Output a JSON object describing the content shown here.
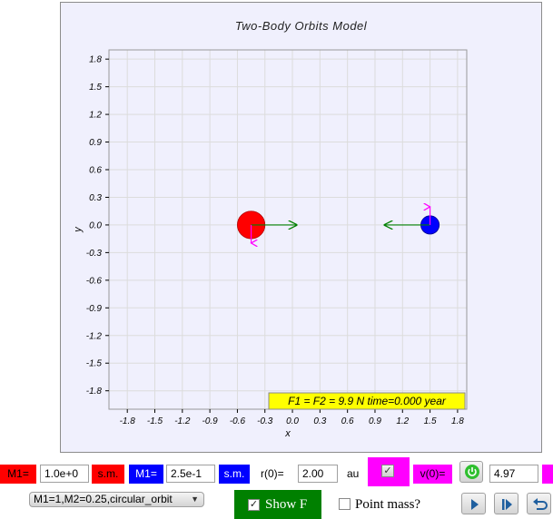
{
  "plot": {
    "title": "Two-Body Orbits Model",
    "xlabel": "x",
    "ylabel": "y",
    "xticks": [
      "-1.8",
      "-1.5",
      "-1.2",
      "-0.9",
      "-0.6",
      "-0.3",
      "0.0",
      "0.3",
      "0.6",
      "0.9",
      "1.2",
      "1.5",
      "1.8"
    ],
    "yticks": [
      "1.8",
      "1.5",
      "1.2",
      "0.9",
      "0.6",
      "0.3",
      "0.0",
      "-0.3",
      "-0.6",
      "-0.9",
      "-1.2",
      "-1.5",
      "-1.8"
    ],
    "range": [
      -2.0,
      1.9
    ],
    "body1": {
      "x": -0.45,
      "y": 0.0,
      "r": 0.15,
      "color": "#ff0000"
    },
    "body2": {
      "x": 1.5,
      "y": 0.0,
      "r": 0.1,
      "color": "#0000ff"
    },
    "force_color": "#008000",
    "velocity_color": "#ff00ff",
    "status": "F1 = F2 = 9.9 N time=0.000 year",
    "status_bg": "#ffff00"
  },
  "controls": {
    "m1_label": "M1=",
    "m1_value": "1.0e+0",
    "m1_unit": "s.m.",
    "m2_label": "M1=",
    "m2_value": "2.5e-1",
    "m2_unit": "s.m.",
    "r0_label": "r(0)=",
    "r0_value": "2.00",
    "r0_unit": "au",
    "v0_label": "v(0)=",
    "v0_value": "4.97",
    "preset": "M1=1,M2=0.25,circular_orbit",
    "show_f_label": "Show F",
    "show_f_checked": true,
    "point_mass_label": "Point mass?",
    "point_mass_checked": false
  },
  "colors": {
    "red": "#ff0000",
    "blue": "#0000ff",
    "magenta": "#ff00ff",
    "green": "#008000"
  }
}
